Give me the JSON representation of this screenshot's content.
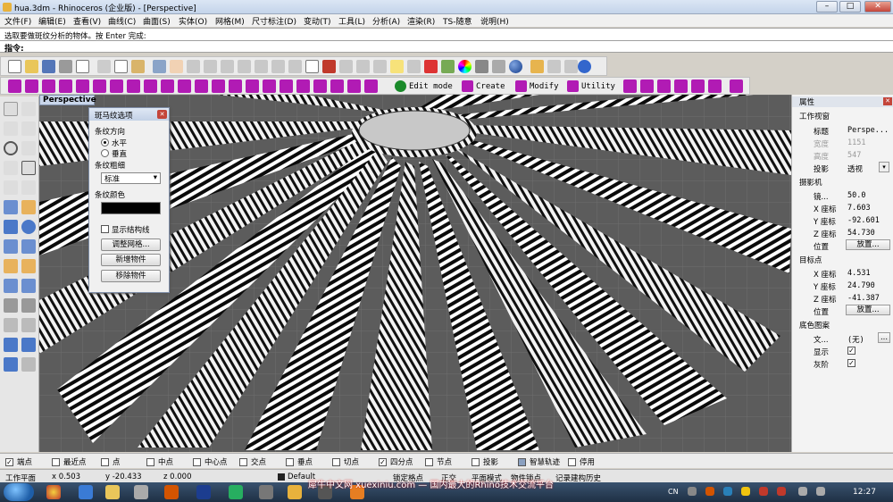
{
  "window": {
    "title": "hua.3dm - Rhinoceros (企业版) - [Perspective]"
  },
  "menu": [
    "文件(F)",
    "编辑(E)",
    "查看(V)",
    "曲线(C)",
    "曲面(S)",
    "实体(O)",
    "网格(M)",
    "尺寸标注(D)",
    "变动(T)",
    "工具(L)",
    "分析(A)",
    "渲染(R)",
    "TS-随意",
    "说明(H)"
  ],
  "command": {
    "history": "选取要做斑纹分析的物体。按 Enter 完成:",
    "prompt": "指令:"
  },
  "toolbar2": {
    "edit_mode": "Edit mode",
    "create": "Create",
    "modify": "Modify",
    "utility": "Utility"
  },
  "viewport": {
    "label": "Perspective"
  },
  "zebra": {
    "title": "斑马纹选项",
    "direction_label": "条纹方向",
    "horizontal": "水平",
    "vertical": "垂直",
    "selected": "水平",
    "thickness_label": "条纹粗细",
    "thickness_value": "标准",
    "color_label": "条纹颜色",
    "color": "#000000",
    "show_structure": "显示结构线",
    "adjust_mesh": "调整网格...",
    "add_object": "新增物件",
    "remove_object": "移除物件"
  },
  "properties": {
    "title": "属性",
    "viewport_section": "工作视窗",
    "title_label": "标题",
    "title_value": "Perspe...",
    "width_label": "宽度",
    "width_value": "1151",
    "height_label": "高度",
    "height_value": "547",
    "projection_label": "投影",
    "projection_value": "透视",
    "camera_section": "摄影机",
    "lens_label": "镜...",
    "lens_value": "50.0",
    "cx_label": "X 座标",
    "cx_value": "7.603",
    "cy_label": "Y 座标",
    "cy_value": "-92.601",
    "cz_label": "Z 座标",
    "cz_value": "54.730",
    "pos_label": "位置",
    "place_btn": "放置...",
    "target_section": "目标点",
    "tx_label": "X 座标",
    "tx_value": "4.531",
    "ty_label": "Y 座标",
    "ty_value": "24.790",
    "tz_label": "Z 座标",
    "tz_value": "-41.387",
    "tpos_label": "位置",
    "tplace_btn": "放置...",
    "bg_section": "底色图案",
    "file_label": "文...",
    "file_value": "(无)",
    "file_btn": "...",
    "show_label": "显示",
    "gray_label": "灰阶"
  },
  "osnap": [
    {
      "label": "端点",
      "checked": true
    },
    {
      "label": "最近点",
      "checked": false
    },
    {
      "label": "点",
      "checked": false
    },
    {
      "label": "中点",
      "checked": false
    },
    {
      "label": "中心点",
      "checked": false
    },
    {
      "label": "交点",
      "checked": false
    },
    {
      "label": "垂点",
      "checked": false
    },
    {
      "label": "切点",
      "checked": false
    },
    {
      "label": "四分点",
      "checked": true
    },
    {
      "label": "节点",
      "checked": false
    },
    {
      "label": "投影",
      "checked": false
    },
    {
      "label": "智慧轨迹",
      "checked": false
    },
    {
      "label": "停用",
      "checked": false
    }
  ],
  "status": {
    "plane": "工作平面",
    "x": "x 0.503",
    "y": "y -20.433",
    "z": "z 0.000",
    "layer": "Default",
    "grid_snap": "锁定格点",
    "ortho": "正交",
    "planar": "平面模式",
    "object_snap": "物件锁点",
    "record": "记录建构历史"
  },
  "taskbar": {
    "watermark": "犀牛中文网 xuexiniu.com — 国内最大的Rhino技术交流平台",
    "lang": "CN",
    "time": "12:27"
  }
}
